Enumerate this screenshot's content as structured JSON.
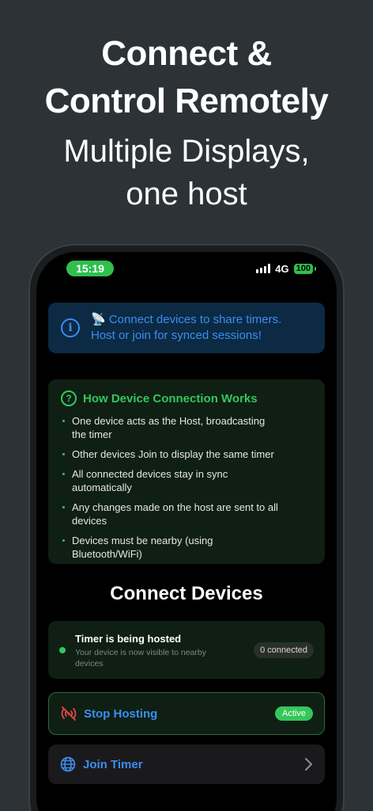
{
  "promo": {
    "headline_line1": "Connect &",
    "headline_line2": "Control Remotely",
    "subhead_line1": "Multiple Displays,",
    "subhead_line2": "one host"
  },
  "status_bar": {
    "time": "15:19",
    "network": "4G",
    "battery": "100"
  },
  "info_banner": {
    "line1": "📡 Connect devices to share timers.",
    "line2": "Host or join for synced sessions!"
  },
  "how_it_works": {
    "title": "How Device Connection Works",
    "items": [
      "One device acts as the Host, broadcasting the timer",
      "Other devices Join to display the same timer",
      "All connected devices stay in sync automatically",
      "Any changes made on the host are sent to all devices",
      "Devices must be nearby (using Bluetooth/WiFi)"
    ]
  },
  "connect": {
    "title": "Connect Devices",
    "host_status": {
      "title": "Timer is being hosted",
      "subtitle": "Your device is now visible to nearby devices",
      "connected_badge": "0 connected"
    },
    "stop_hosting": {
      "label": "Stop Hosting",
      "badge": "Active"
    },
    "join_timer": {
      "label": "Join Timer"
    }
  },
  "colors": {
    "background": "#2c3236",
    "accent_blue": "#3a8ef0",
    "accent_green": "#34c759",
    "danger_red": "#e5484d"
  }
}
